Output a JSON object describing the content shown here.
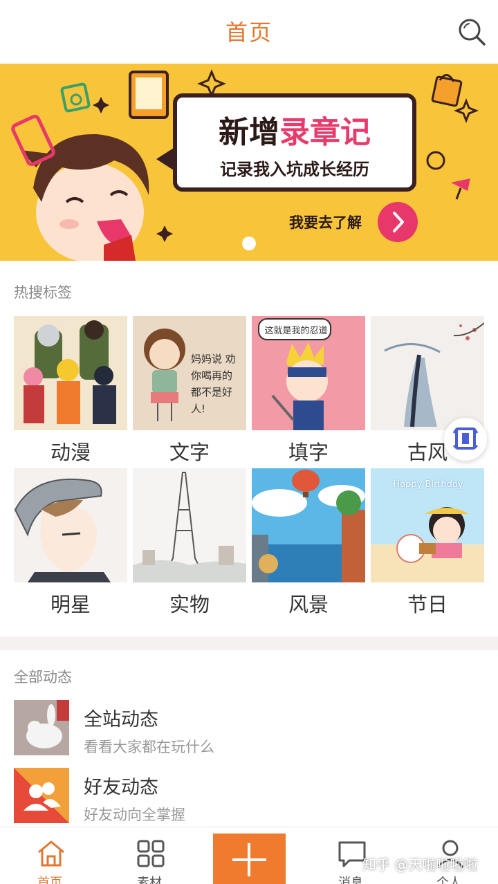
{
  "header": {
    "title": "首页",
    "search_icon": "search-icon"
  },
  "banner": {
    "headline_black": "新增",
    "headline_pink": "录章记",
    "subline": "记录我入坑成长经历",
    "cta": "我要去了解",
    "page_count": 1,
    "active_page": 1
  },
  "hot_tags": {
    "label": "热搜标签",
    "items": [
      {
        "label": "动漫"
      },
      {
        "label": "文字",
        "image_text": "妈妈说 劝你喝再的 都不是好人!"
      },
      {
        "label": "填字",
        "image_text": "这就是我的忍道"
      },
      {
        "label": "古风"
      },
      {
        "label": "明星"
      },
      {
        "label": "实物"
      },
      {
        "label": "风景"
      },
      {
        "label": "节日",
        "image_text": "Happy Birthday"
      }
    ]
  },
  "feed": {
    "label": "全部动态",
    "items": [
      {
        "title": "全站动态",
        "subtitle": "看看大家都在玩什么"
      },
      {
        "title": "好友动态",
        "subtitle": "好友动向全掌握"
      }
    ]
  },
  "bottom_nav": {
    "items": [
      {
        "label": "首页",
        "icon": "home-icon",
        "active": true
      },
      {
        "label": "素材",
        "icon": "grid-icon",
        "active": false
      },
      {
        "label": "",
        "icon": "plus-icon",
        "active": false
      },
      {
        "label": "消息",
        "icon": "message-icon",
        "active": false
      },
      {
        "label": "个人",
        "icon": "person-icon",
        "active": false
      }
    ]
  },
  "watermark": "知乎 @天啦啦啦啦",
  "colors": {
    "accent": "#e4772f",
    "banner_bg": "#f8c43a",
    "pink": "#e83b6b",
    "add_button": "#f07a2e"
  }
}
